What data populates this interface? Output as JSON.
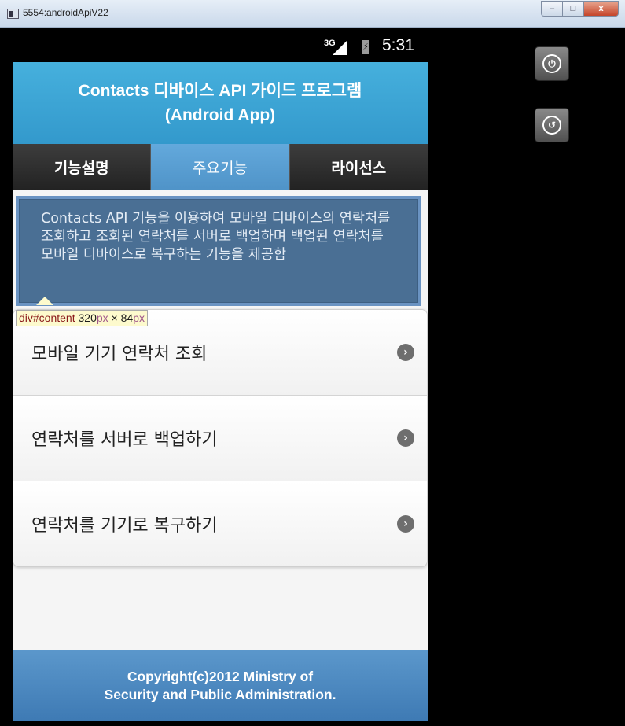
{
  "window": {
    "title": "5554:androidApiV22",
    "minimize_label": "–",
    "maximize_label": "□",
    "close_label": "x"
  },
  "status_bar": {
    "network": "3G",
    "battery_glyph": "⚡",
    "time": "5:31"
  },
  "header": {
    "title_line1": "Contacts 디바이스 API 가이드 프로그램",
    "title_line2": "(Android App)"
  },
  "tabs": [
    {
      "label": "기능설명",
      "active": false
    },
    {
      "label": "주요기능",
      "active": true
    },
    {
      "label": "라이선스",
      "active": false
    }
  ],
  "content": {
    "description": "Contacts API 기능을 이용하여 모바일 디바이스의 연락처를 조회하고 조회된 연락처를 서버로 백업하며 백업된 연락처를 모바일 디바이스로 복구하는 기능을 제공함"
  },
  "inspector_tooltip": {
    "selector": "div#content",
    "width_value": " 320",
    "width_unit": "px",
    "separator": " × ",
    "height_value": "84",
    "height_unit": "px"
  },
  "menu": {
    "items": [
      {
        "label": "모바일 기기 연락처 조회"
      },
      {
        "label": "연락처를 서버로 백업하기"
      },
      {
        "label": "연락처를 기기로 복구하기"
      }
    ]
  },
  "footer": {
    "line1": "Copyright(c)2012 Ministry of",
    "line2": "Security and Public Administration."
  },
  "emulator_controls": {
    "power_glyph": "⏻",
    "back_glyph": "↺"
  }
}
